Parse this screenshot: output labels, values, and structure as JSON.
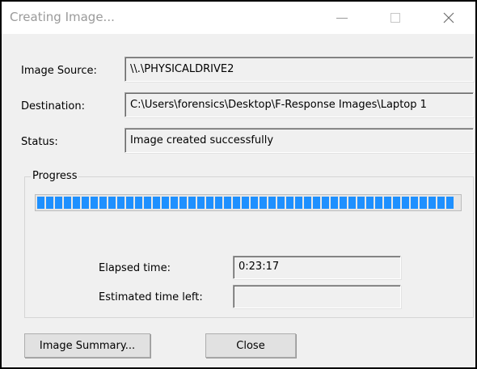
{
  "window": {
    "title": "Creating Image..."
  },
  "titlebar_icons": {
    "minimize": "minimize-icon",
    "maximize": "maximize-icon",
    "close": "close-icon"
  },
  "fields": {
    "image_source": {
      "label": "Image Source:",
      "value": "\\\\.\\PHYSICALDRIVE2"
    },
    "destination": {
      "label": "Destination:",
      "value": "C:\\Users\\forensics\\Desktop\\F-Response Images\\Laptop 1"
    },
    "status": {
      "label": "Status:",
      "value": "Image created successfully"
    }
  },
  "progress": {
    "group_title": "Progress",
    "fraction": 1.0,
    "bar_color": "#1e90ff",
    "elapsed": {
      "label": "Elapsed time:",
      "value": "0:23:17"
    },
    "remaining": {
      "label": "Estimated time left:",
      "value": ""
    }
  },
  "buttons": {
    "summary": "Image Summary...",
    "close": "Close"
  }
}
